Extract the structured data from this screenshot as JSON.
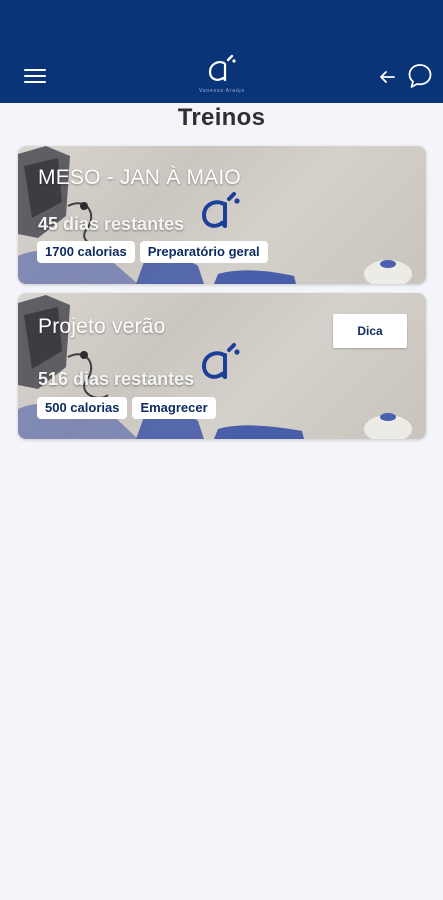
{
  "header": {
    "logo_caption": "Vanessa Araújo",
    "menu_icon": "hamburger-icon",
    "back_icon": "arrow-left-icon",
    "chat_icon": "chat-bubble-icon"
  },
  "page": {
    "title": "Treinos"
  },
  "workouts": [
    {
      "title": "MESO - JAN À MAIO",
      "days_remaining": "45 dias restantes",
      "tags": [
        "1700 calorias",
        "Preparatório geral"
      ]
    },
    {
      "title": "Projeto verão",
      "days_remaining": "516 dias restantes",
      "tags": [
        "500 calorias",
        "Emagrecer"
      ],
      "tip_label": "Dica"
    }
  ],
  "colors": {
    "brand": "#0a3478",
    "background": "#f3f5fa",
    "chip_text": "#0e2b63"
  }
}
